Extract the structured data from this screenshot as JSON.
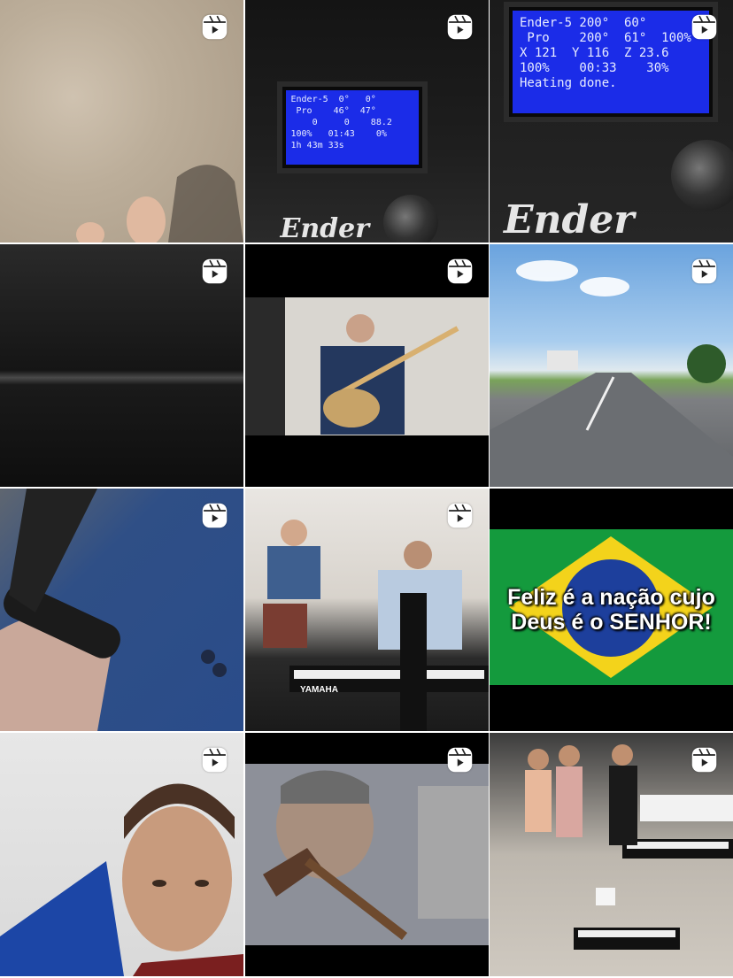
{
  "reel_icon": "reels-icon",
  "tiles": [
    {
      "label": "sand-with-feet"
    },
    {
      "label": "ender-printer-lcd-small",
      "lcd": {
        "rows": [
          "Ender-5  0°   0°",
          " Pro    46°  47°",
          "    0     0    88.2",
          "100%   01:43    0%",
          "1h 43m 33s"
        ],
        "brand": "Ender"
      }
    },
    {
      "label": "ender-printer-lcd-large",
      "lcd": {
        "rows": [
          "Ender-5 200°  60°",
          " Pro    200°  61°  100%",
          "X 121  Y 116  Z 23.6",
          "100%    00:33    30%",
          "Heating done."
        ],
        "brand": "Ender"
      }
    },
    {
      "label": "black-metal-surface"
    },
    {
      "label": "guitar-player-suit"
    },
    {
      "label": "highway-road"
    },
    {
      "label": "blue-suit-sleeve-watch"
    },
    {
      "label": "band-drums-keyboard",
      "keyboard_brand": "YAMAHA"
    },
    {
      "label": "brazil-flag-text",
      "line1": "Feliz é a nação cujo",
      "line2": "Deus é o SENHOR!"
    },
    {
      "label": "selfie-man"
    },
    {
      "label": "roman-soldier-hammer"
    },
    {
      "label": "church-orchestra-keyboards"
    }
  ]
}
